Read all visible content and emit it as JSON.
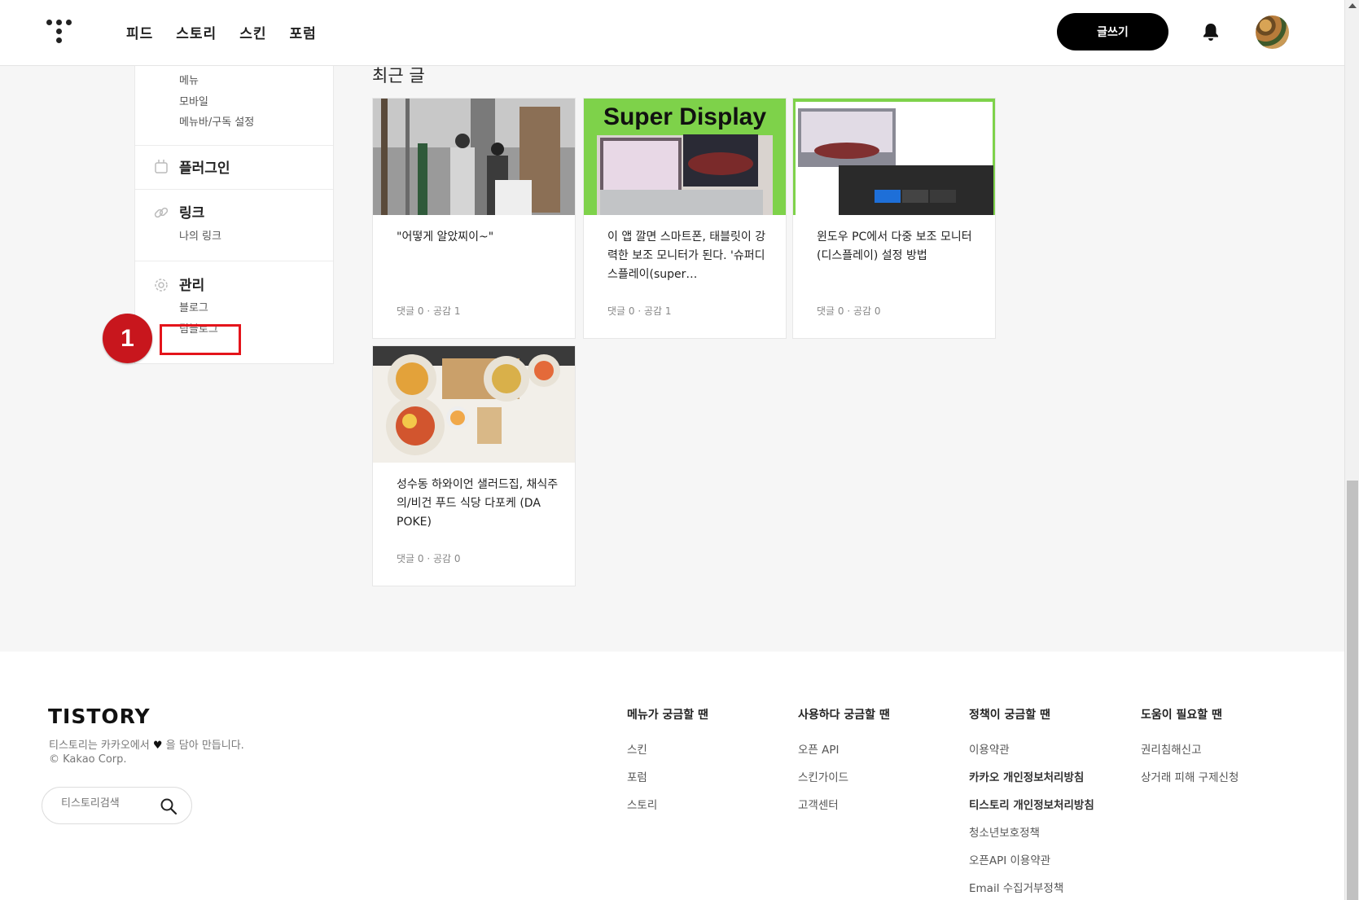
{
  "header": {
    "nav": [
      "피드",
      "스토리",
      "스킨",
      "포럼"
    ],
    "write_label": "글쓰기"
  },
  "sidebar": {
    "top_sub": [
      "메뉴",
      "모바일",
      "메뉴바/구독 설정"
    ],
    "plugin": {
      "title": "플러그인"
    },
    "link": {
      "title": "링크",
      "sub": [
        "나의 링크"
      ]
    },
    "manage": {
      "title": "관리",
      "sub": [
        "블로그",
        "팀블로그"
      ]
    }
  },
  "annotation": {
    "badge": "1"
  },
  "main": {
    "section_title": "최근 글",
    "posts": [
      {
        "title": "\"어떻게 알았찌이~\"",
        "meta": "댓글 0 · 공감 1"
      },
      {
        "title": "이 앱 깔면 스마트폰, 태블릿이 강력한 보조 모니터가 된다. '슈퍼디스플레이(super…",
        "meta": "댓글 0 · 공감 1",
        "thumb_text": "Super Display"
      },
      {
        "title": "윈도우 PC에서 다중 보조 모니터(디스플레이) 설정 방법",
        "meta": "댓글 0 · 공감 0"
      },
      {
        "title": "성수동 하와이언 샐러드집, 채식주의/비건 푸드 식당 다포케 (DA POKE)",
        "meta": "댓글 0 · 공감 0"
      }
    ]
  },
  "footer": {
    "logo": "TISTORY",
    "tagline_pre": "티스토리는 카카오에서",
    "tagline_post": "을 담아 만듭니다.",
    "copyright": "© Kakao Corp.",
    "search_placeholder": "티스토리검색",
    "columns": [
      {
        "title": "메뉴가 궁금할 땐",
        "links": [
          "스킨",
          "포럼",
          "스토리"
        ]
      },
      {
        "title": "사용하다 궁금할 땐",
        "links": [
          "오픈 API",
          "스킨가이드",
          "고객센터"
        ]
      },
      {
        "title": "정책이 궁금할 땐",
        "links": [
          "이용약관",
          "카카오 개인정보처리방침",
          "티스토리 개인정보처리방침",
          "청소년보호정책",
          "오픈API 이용약관",
          "Email 수집거부정책"
        ]
      },
      {
        "title": "도움이 필요할 땐",
        "links": [
          "권리침해신고",
          "상거래 피해 구제신청"
        ]
      }
    ]
  },
  "colors": {
    "accent": "#000000",
    "annotation_red": "#c8161d",
    "highlight_red": "#e4141b",
    "display_green": "#7ed24a"
  }
}
